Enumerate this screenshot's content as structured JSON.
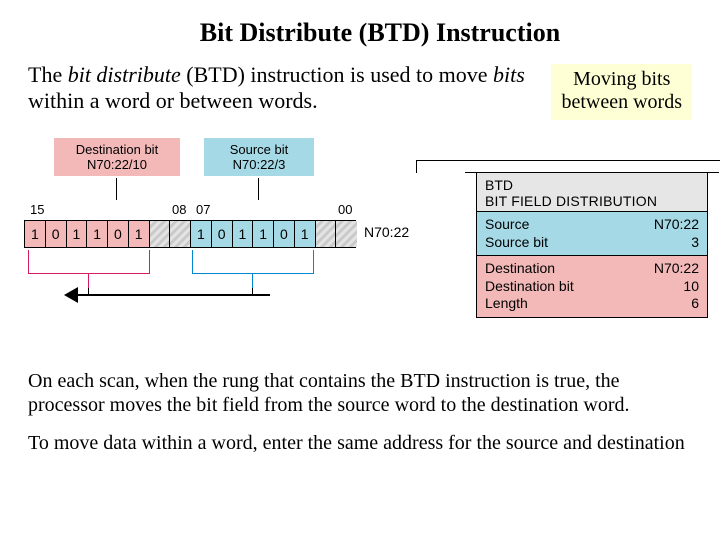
{
  "title": "Bit Distribute (BTD) Instruction",
  "intro": {
    "pre": "The ",
    "em": "bit distribute",
    "mid": " (BTD) instruction is used to move ",
    "em2": "bits",
    "post": " within a word or between words."
  },
  "caption": {
    "line1": "Moving bits",
    "line2": "between words"
  },
  "tagbox": {
    "dest": {
      "label": "Destination bit",
      "addr": "N70:22/10"
    },
    "src": {
      "label": "Source bit",
      "addr": "N70:22/3"
    }
  },
  "scale": {
    "b15": "15",
    "b08": "08",
    "b07": "07",
    "b00": "00"
  },
  "word_label": "N70:22",
  "bits": [
    "1",
    "0",
    "1",
    "1",
    "0",
    "1",
    "",
    "",
    "1",
    "0",
    "1",
    "1",
    "0",
    "1",
    "",
    ""
  ],
  "instr": {
    "mnemonic": "BTD",
    "fullname": "BIT FIELD DISTRIBUTION",
    "src": {
      "source_lbl": "Source",
      "source_val": "N70:22",
      "srcbit_lbl": "Source bit",
      "srcbit_val": "3"
    },
    "dest": {
      "dest_lbl": "Destination",
      "dest_val": "N70:22",
      "dbit_lbl": "Destination bit",
      "dbit_val": "10",
      "len_lbl": "Length",
      "len_val": "6"
    }
  },
  "para1": "On each scan, when the rung that contains the BTD instruction is true, the processor moves the bit field from the source word to the destination word.",
  "para2": "To move data within a word, enter the same address for the source and destination"
}
